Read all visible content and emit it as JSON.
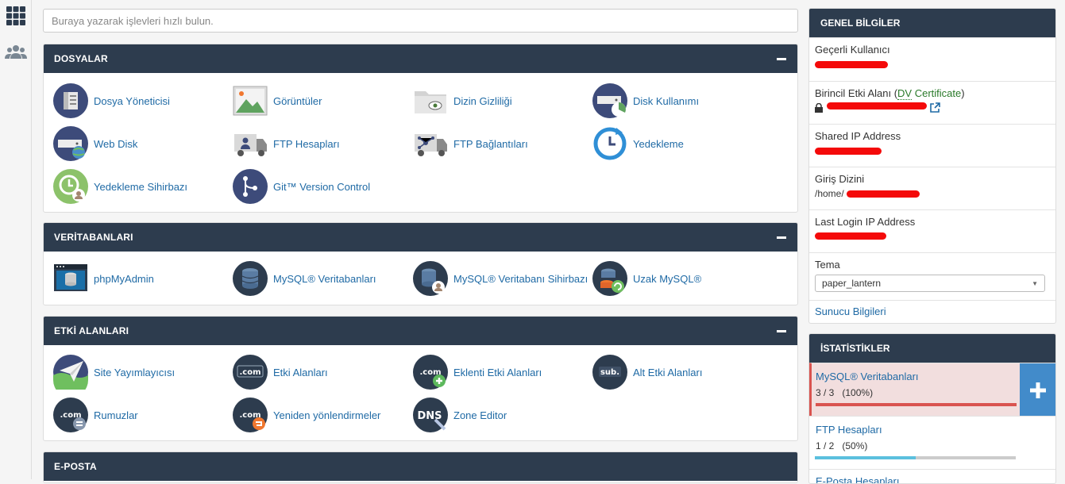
{
  "search": {
    "placeholder": "Buraya yazarak işlevleri hızlı bulun."
  },
  "groups": {
    "files": {
      "title": "DOSYALAR",
      "items": [
        {
          "label": "Dosya Yöneticisi"
        },
        {
          "label": "Görüntüler"
        },
        {
          "label": "Dizin Gizliliği"
        },
        {
          "label": "Disk Kullanımı"
        },
        {
          "label": "Web Disk"
        },
        {
          "label": "FTP Hesapları"
        },
        {
          "label": "FTP Bağlantıları"
        },
        {
          "label": "Yedekleme"
        },
        {
          "label": "Yedekleme Sihirbazı"
        },
        {
          "label": "Git™ Version Control"
        }
      ]
    },
    "databases": {
      "title": "VERİTABANLARI",
      "items": [
        {
          "label": "phpMyAdmin"
        },
        {
          "label": "MySQL® Veritabanları"
        },
        {
          "label": "MySQL® Veritabanı Sihirbazı"
        },
        {
          "label": "Uzak MySQL®"
        }
      ]
    },
    "domains": {
      "title": "ETKİ ALANLARI",
      "items": [
        {
          "label": "Site Yayımlayıcısı"
        },
        {
          "label": "Etki Alanları",
          "icon_text": ".com"
        },
        {
          "label": "Eklenti Etki Alanları",
          "icon_text": ".com"
        },
        {
          "label": "Alt Etki Alanları",
          "icon_text": "sub."
        },
        {
          "label": "Rumuzlar",
          "icon_text": ".com"
        },
        {
          "label": "Yeniden yönlendirmeler",
          "icon_text": ".com"
        },
        {
          "label": "Zone Editor",
          "icon_text": "DNS"
        }
      ]
    },
    "email": {
      "title": "E-POSTA"
    }
  },
  "general": {
    "title": "GENEL BİLGİLER",
    "current_user": {
      "label": "Geçerli Kullanıcı"
    },
    "primary_domain": {
      "label": "Birincil Etki Alanı (",
      "dv": "DV",
      "cert": " Certificate",
      "close": ")"
    },
    "shared_ip": {
      "label": "Shared IP Address"
    },
    "home_dir": {
      "label": "Giriş Dizini",
      "value_prefix": "/home/"
    },
    "last_login": {
      "label": "Last Login IP Address"
    },
    "theme": {
      "label": "Tema",
      "value": "paper_lantern"
    },
    "server_info": "Sunucu Bilgileri"
  },
  "stats": {
    "title": "İSTATİSTİKLER",
    "items": [
      {
        "name": "MySQL® Veritabanları",
        "value": "3 / 3",
        "percent": "(100%)",
        "fraction": 1.0,
        "color": "#d9534f",
        "state": "danger"
      },
      {
        "name": "FTP Hesapları",
        "value": "1 / 2",
        "percent": "(50%)",
        "fraction": 0.5,
        "color": "#5bc0de",
        "state": "normal"
      },
      {
        "name": "E-Posta Hesapları"
      }
    ]
  },
  "colors": {
    "header": "#2d3c4e",
    "link": "#1f6aa5",
    "redaction": "#f40a0a"
  }
}
